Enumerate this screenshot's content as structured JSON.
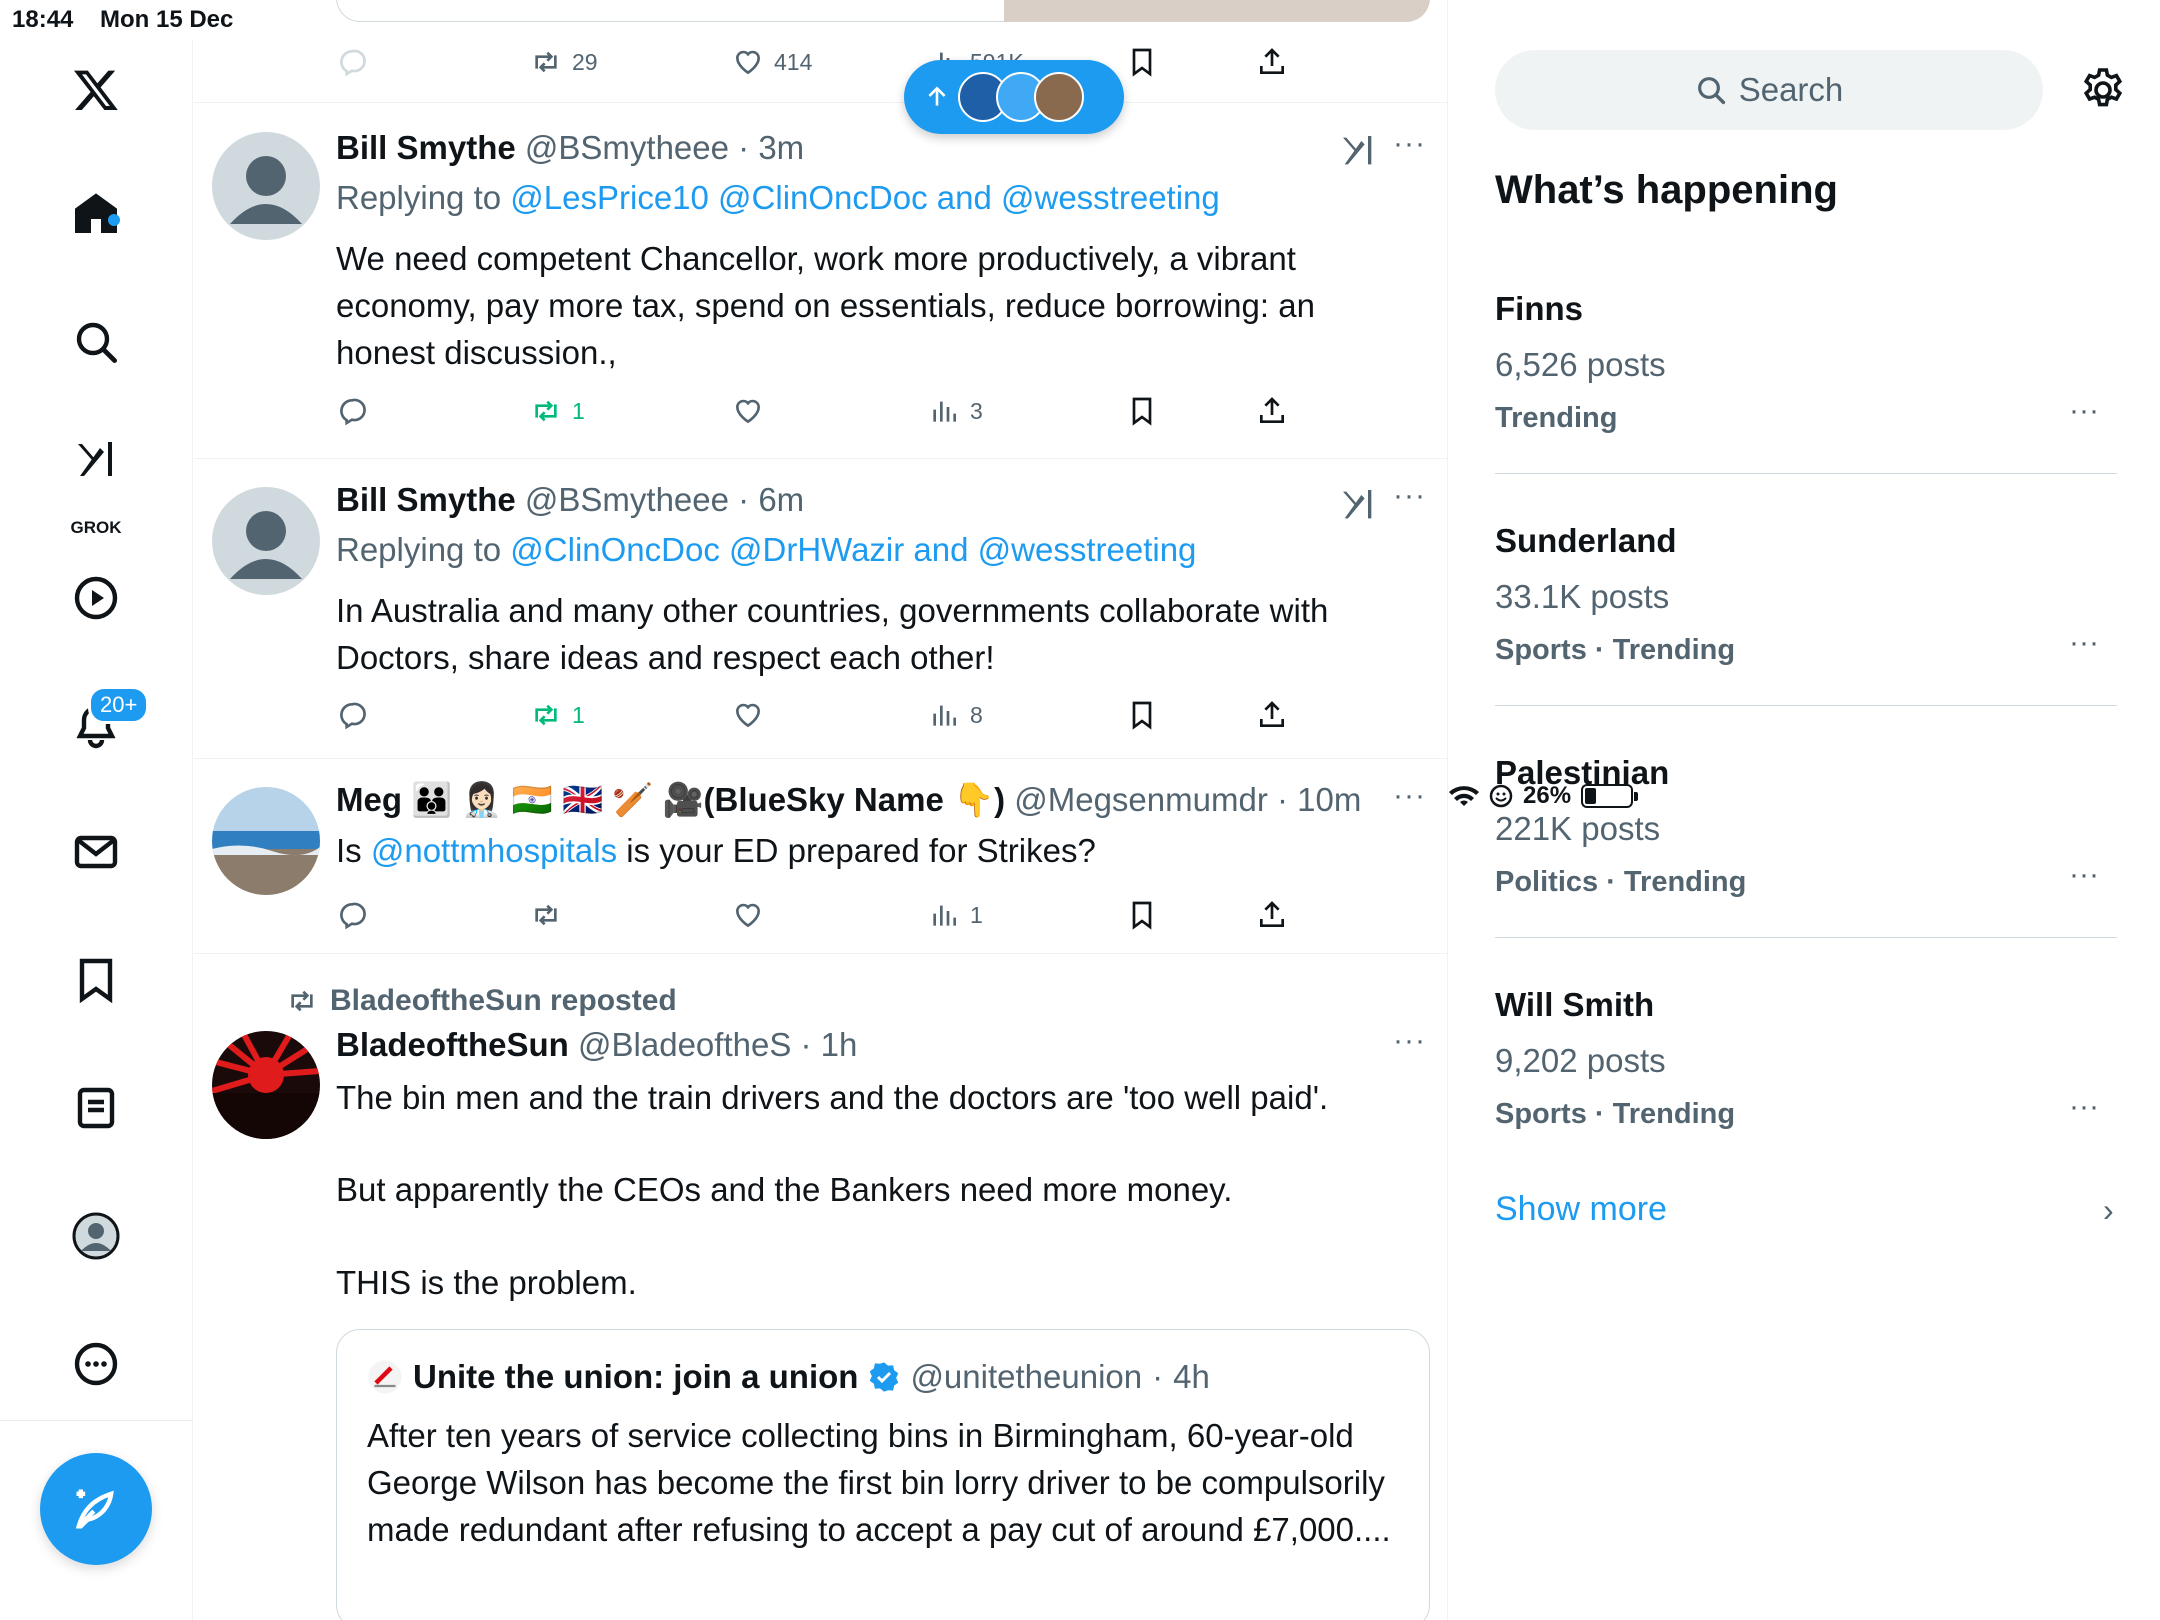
{
  "status": {
    "time": "18:44",
    "date": "Mon 15 Dec",
    "battery": "26%",
    "battery_level": 0.26
  },
  "nav": {
    "grok_label": "GROK",
    "notifications_badge": "20+"
  },
  "top_actions": {
    "retweets": "29",
    "likes": "414",
    "views": "591K"
  },
  "tweets": [
    {
      "name": "Bill Smythe",
      "handle": "@BSmytheee",
      "time": "3m",
      "replying_prefix": "Replying to",
      "replying_links": "@LesPrice10 @ClinOncDoc and @wesstreeting",
      "text": "We need competent Chancellor, work more productively, a vibrant economy, pay more tax, spend on essentials, reduce borrowing: an honest discussion.,",
      "retweets": "1",
      "views": "3"
    },
    {
      "name": "Bill Smythe",
      "handle": "@BSmytheee",
      "time": "6m",
      "replying_prefix": "Replying to",
      "replying_links": "@ClinOncDoc @DrHWazir and @wesstreeting",
      "text": "In Australia and many other countries, governments collaborate with Doctors, share ideas and respect each other!",
      "retweets": "1",
      "views": "8"
    },
    {
      "name": "Meg 🧑‍🧑‍🧒 👩🏻‍⚕️ 🇮🇳 🇬🇧 🏏 🎥(BlueSky Name 👇)",
      "handle": "@Megsenmumdr",
      "time": "10m",
      "text_prefix": "Is",
      "text_link": "@nottmhospitals",
      "text_suffix": "is your ED prepared for Strikes?",
      "views": "1"
    },
    {
      "repost_label": "BladeoftheSun reposted",
      "name": "BladeoftheSun",
      "handle": "@BladeoftheS",
      "time": "1h",
      "line1": "The bin men and the train drivers and the doctors are 'too well paid'.",
      "line2": "But apparently the CEOs and the Bankers need more money.",
      "line3": "THIS is the problem."
    }
  ],
  "quote": {
    "name": "Unite the union: join a union",
    "handle": "@unitetheunion",
    "time": "4h",
    "text": "After ten years of service collecting bins in Birmingham, 60-year-old George Wilson has become the first bin lorry driver to be compulsorily made redundant after refusing to accept a pay cut of around £7,000...."
  },
  "sidebar": {
    "search_placeholder": "Search",
    "heading": "What’s happening",
    "trends": [
      {
        "name": "Finns",
        "posts": "6,526 posts",
        "category": "Trending"
      },
      {
        "name": "Sunderland",
        "posts": "33.1K posts",
        "category": "Sports · Trending"
      },
      {
        "name": "Palestinian",
        "posts": "221K posts",
        "category": "Politics · Trending"
      },
      {
        "name": "Will Smith",
        "posts": "9,202 posts",
        "category": "Sports · Trending"
      }
    ],
    "show_more": "Show more"
  },
  "colors": {
    "accent": "#1d9bf0",
    "retweet_active": "#00ba7c",
    "muted": "#536471"
  }
}
